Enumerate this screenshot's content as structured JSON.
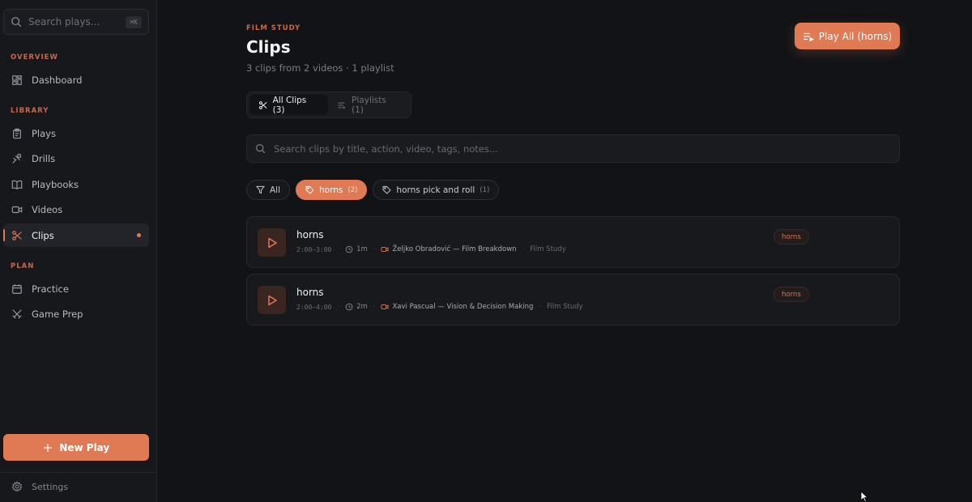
{
  "sidebar": {
    "search_placeholder": "Search plays...",
    "search_shortcut": "⌘K",
    "sections": {
      "overview": "OVERVIEW",
      "library": "LIBRARY",
      "plan": "PLAN"
    },
    "items": {
      "dashboard": "Dashboard",
      "plays": "Plays",
      "drills": "Drills",
      "playbooks": "Playbooks",
      "videos": "Videos",
      "clips": "Clips",
      "practice": "Practice",
      "game_prep": "Game Prep"
    },
    "new_play": "New Play",
    "settings": "Settings"
  },
  "header": {
    "eyebrow": "FILM STUDY",
    "title": "Clips",
    "subtitle": "3 clips from 2 videos · 1 playlist",
    "play_all": "Play All (horns)"
  },
  "tabs": {
    "all_clips": "All Clips (3)",
    "playlists": "Playlists (1)"
  },
  "clip_search": {
    "placeholder": "Search clips by title, action, video, tags, notes..."
  },
  "filters": {
    "all": "All",
    "chips": [
      {
        "label": "horns",
        "count": "(2)"
      },
      {
        "label": "horns pick and roll",
        "count": "(1)"
      }
    ]
  },
  "clips": [
    {
      "title": "horns",
      "time": "2:00–3:00",
      "duration": "1m",
      "video": "Željko Obradović — Film Breakdown",
      "category": "Film Study",
      "tag": "horns"
    },
    {
      "title": "horns",
      "time": "2:00–4:00",
      "duration": "2m",
      "video": "Xavi Pascual — Vision & Decision Making",
      "category": "Film Study",
      "tag": "horns"
    }
  ],
  "colors": {
    "accent": "#e07a55",
    "background": "#121316",
    "sidebar": "#17181c"
  }
}
